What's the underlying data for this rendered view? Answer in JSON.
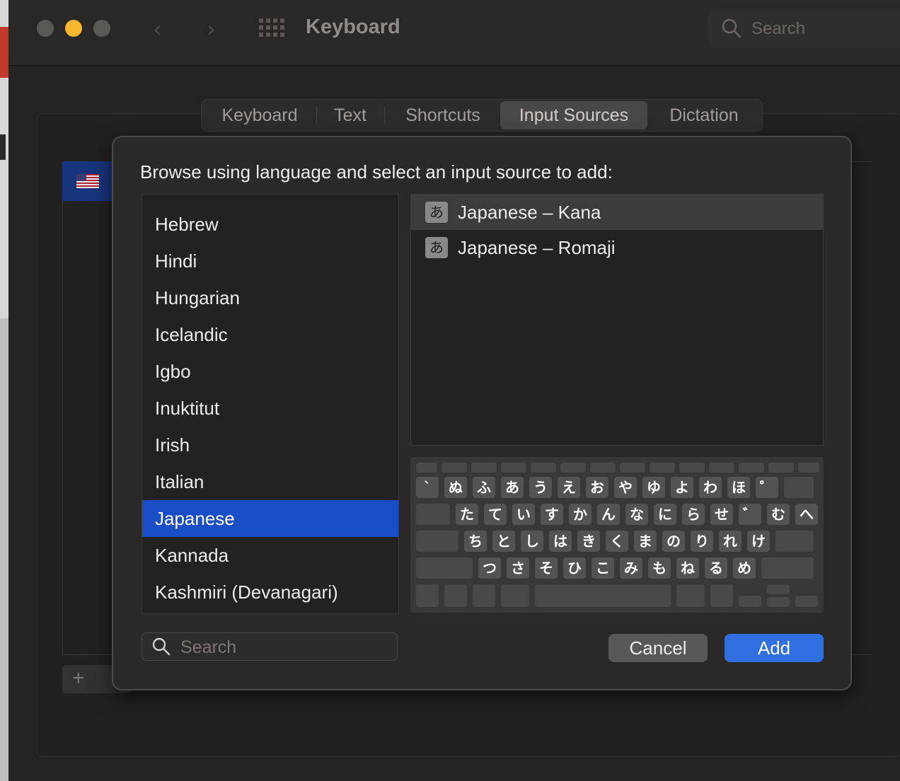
{
  "window": {
    "title": "Keyboard",
    "search_placeholder": "Search",
    "back_glyph": "‹",
    "forward_glyph": "›"
  },
  "tabs": [
    {
      "label": "Keyboard"
    },
    {
      "label": "Text"
    },
    {
      "label": "Shortcuts"
    },
    {
      "label": "Input Sources",
      "selected": true
    },
    {
      "label": "Dictation"
    }
  ],
  "sheet": {
    "prompt": "Browse using language and select an input source to add:",
    "languages": [
      "Hebrew",
      "Hindi",
      "Hungarian",
      "Icelandic",
      "Igbo",
      "Inuktitut",
      "Irish",
      "Italian",
      "Japanese",
      "Kannada",
      "Kashmiri (Devanagari)"
    ],
    "selected_language": "Japanese",
    "sources": [
      {
        "icon": "あ",
        "label": "Japanese – Kana",
        "selected": true
      },
      {
        "icon": "あ",
        "label": "Japanese – Romaji",
        "selected": false
      }
    ],
    "keyboard_rows": {
      "row1": [
        "`",
        "ぬ",
        "ふ",
        "あ",
        "う",
        "え",
        "お",
        "や",
        "ゆ",
        "よ",
        "わ",
        "ほ",
        "゜"
      ],
      "row2": [
        "た",
        "て",
        "い",
        "す",
        "か",
        "ん",
        "な",
        "に",
        "ら",
        "せ",
        "゛",
        "む",
        "へ"
      ],
      "row3": [
        "ち",
        "と",
        "し",
        "は",
        "き",
        "く",
        "ま",
        "の",
        "り",
        "れ",
        "け"
      ],
      "row4": [
        "つ",
        "さ",
        "そ",
        "ひ",
        "こ",
        "み",
        "も",
        "ね",
        "る",
        "め"
      ]
    },
    "search_placeholder": "Search",
    "cancel_label": "Cancel",
    "add_label": "Add"
  },
  "colors": {
    "selection": "#1a4ec7",
    "add_button": "#2f6fdf",
    "close_light": "#5b5956",
    "minimize_light": "#f5b82e",
    "zoom_light": "#5b5956"
  },
  "icons": {
    "search": "magnifier-icon",
    "grid": "app-grid-icon",
    "flag": "us-flag-icon",
    "plus": "plus-icon"
  },
  "background": {
    "plus_label": "+"
  }
}
